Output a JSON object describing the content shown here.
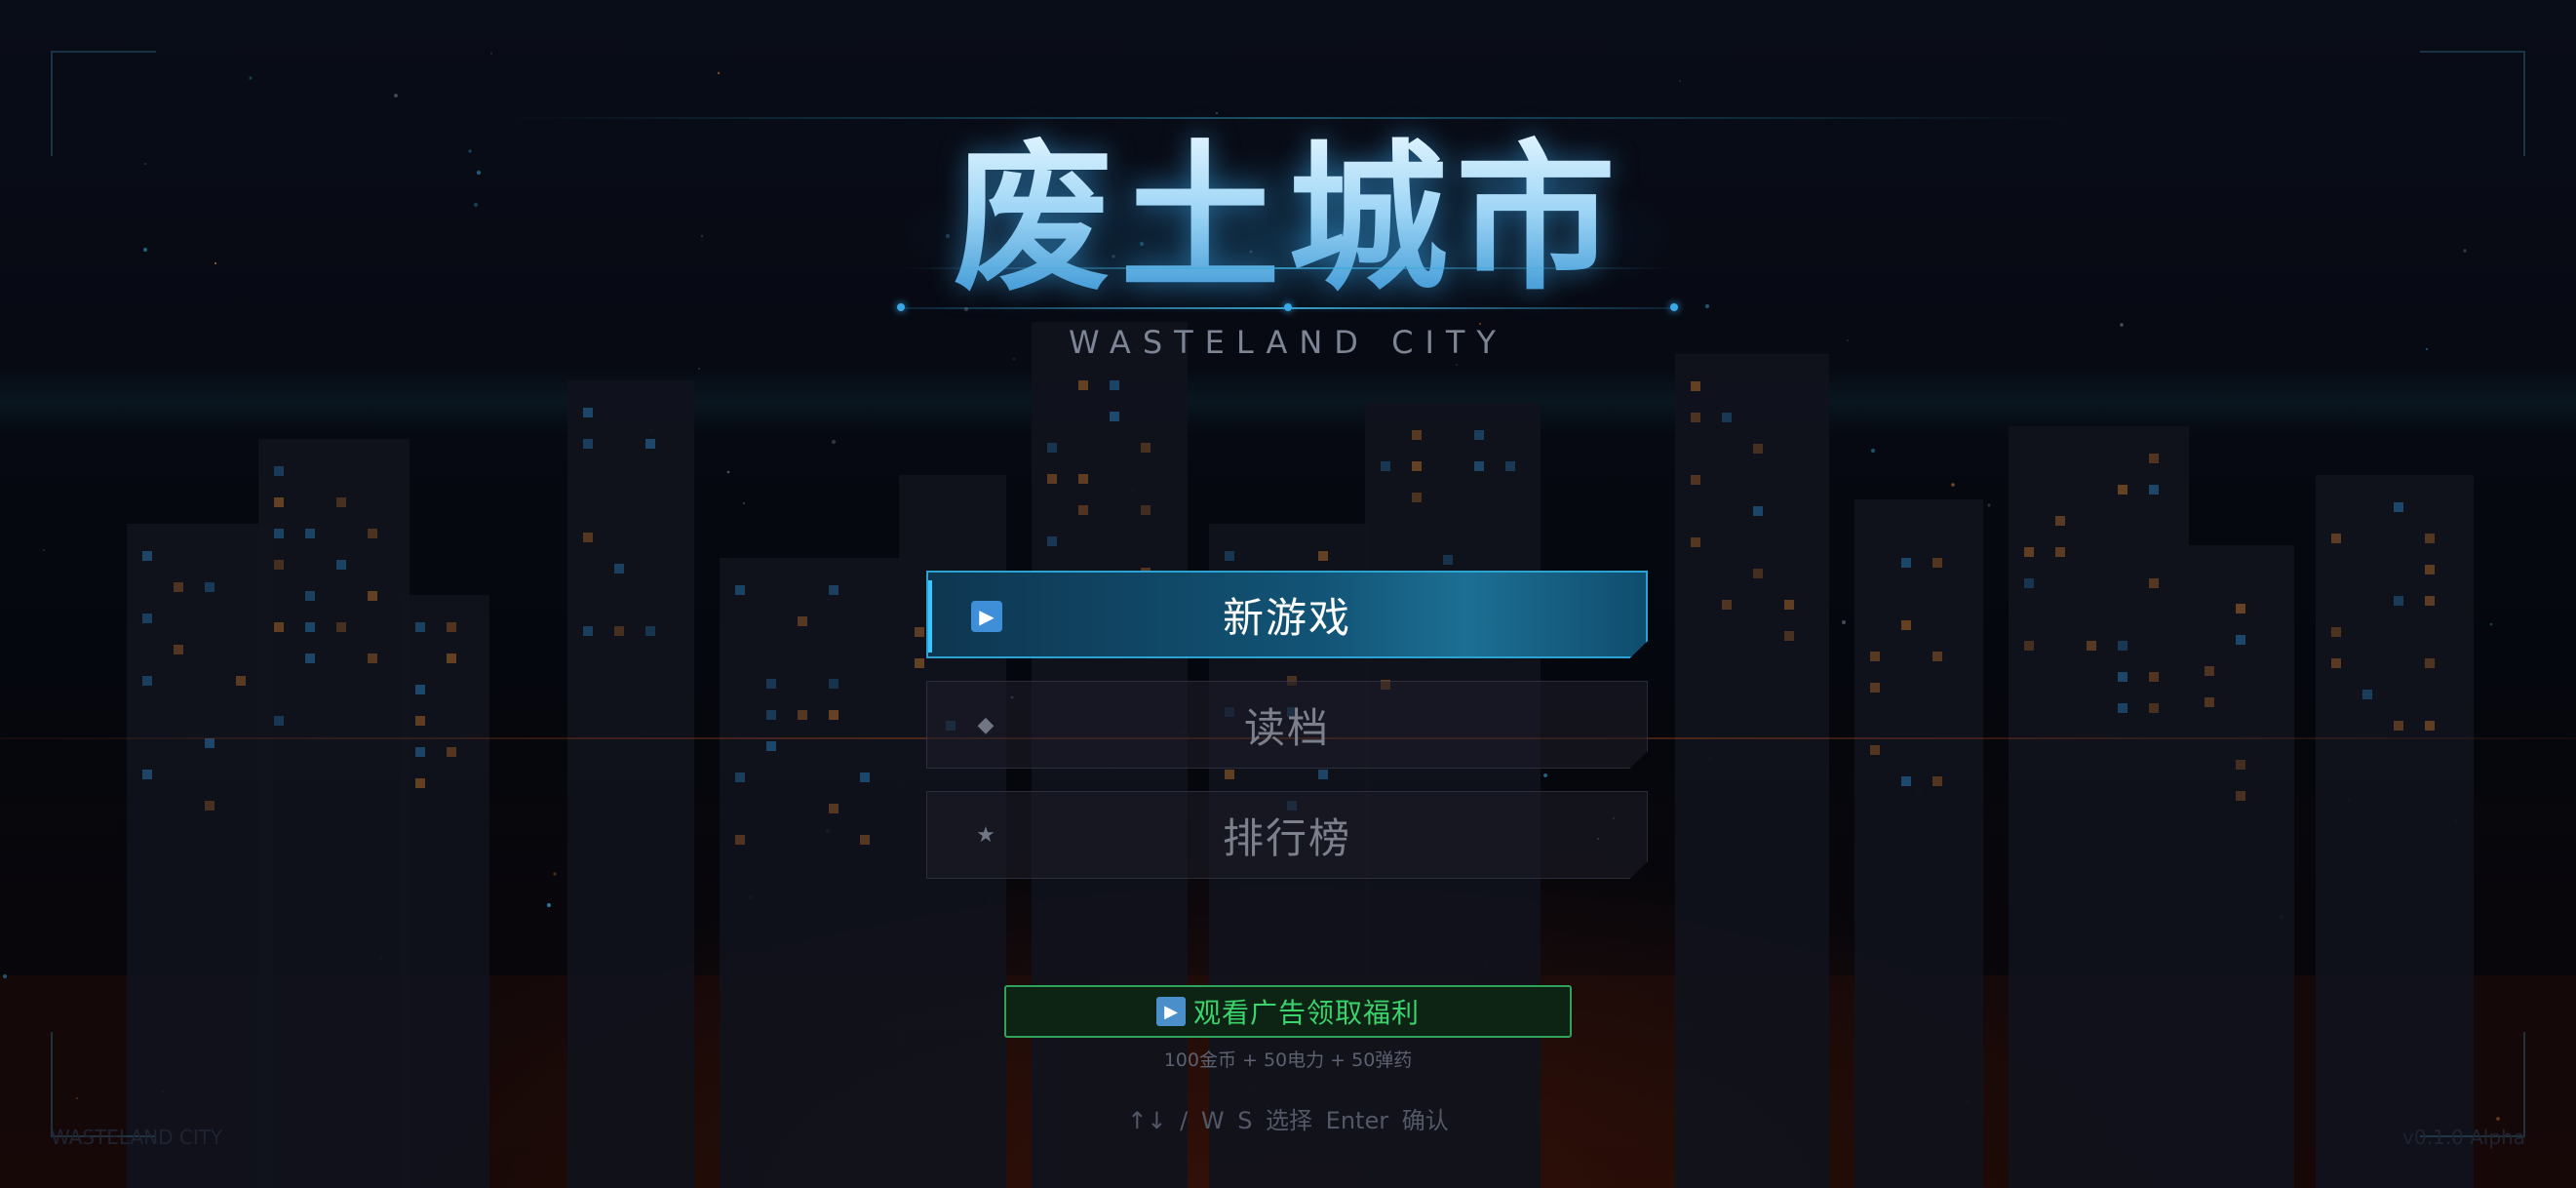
{
  "title": {
    "main": "废土城市",
    "subtitle": "WASTELAND CITY"
  },
  "menu": {
    "items": [
      {
        "id": "new",
        "icon": "play-icon",
        "glyph": "▶",
        "label": "新游戏",
        "selected": true
      },
      {
        "id": "load",
        "icon": "diamond-icon",
        "glyph": "◆",
        "label": "读档",
        "selected": false
      },
      {
        "id": "rank",
        "icon": "star-icon",
        "glyph": "★",
        "label": "排行榜",
        "selected": false
      }
    ]
  },
  "ad": {
    "icon": "play-icon",
    "glyph": "▶",
    "label": "观看广告领取福利",
    "reward": "100金币 + 50电力 + 50弹药"
  },
  "controls_hint": "↑↓ / W S  选择     Enter  确认",
  "footer": {
    "brand": "WASTELAND CITY",
    "version": "v0.1.0 Alpha"
  },
  "colors": {
    "accent": "#2aa3d3",
    "title_glow": "#3aa8e6",
    "ad_green": "#3bd36c",
    "sky": "#070a12",
    "ember": "#8c280a"
  }
}
